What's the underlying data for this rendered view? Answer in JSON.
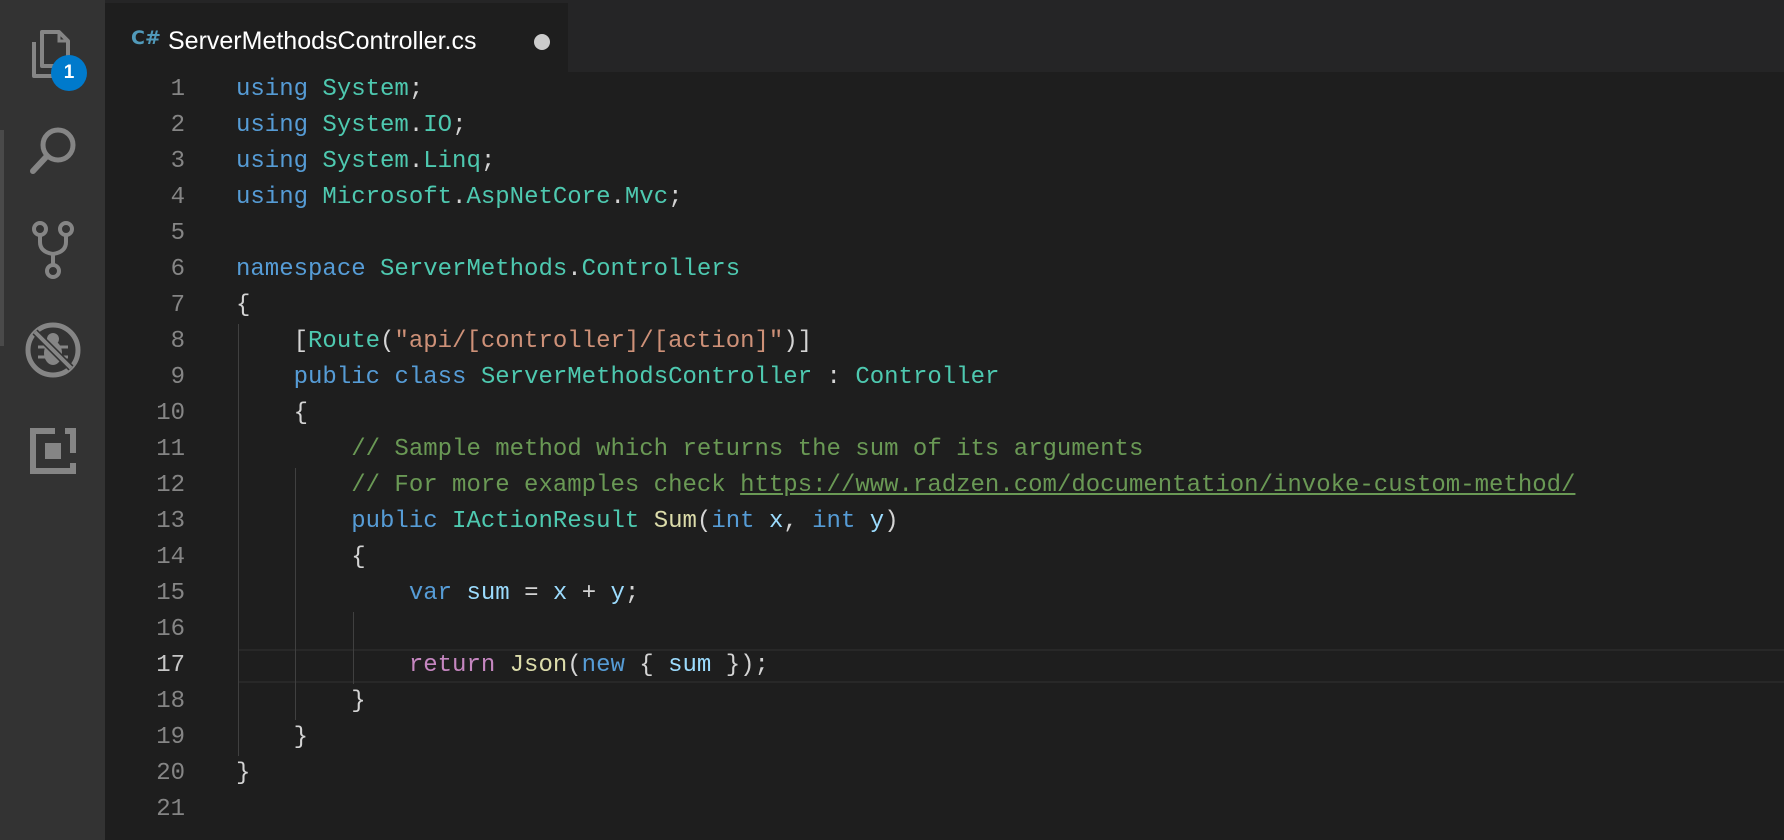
{
  "activity_bar": {
    "items": [
      {
        "name": "explorer",
        "icon": "files-icon",
        "badge": "1"
      },
      {
        "name": "search",
        "icon": "search-icon"
      },
      {
        "name": "source-control",
        "icon": "source-control-icon"
      },
      {
        "name": "debug",
        "icon": "debug-icon"
      },
      {
        "name": "extensions",
        "icon": "extensions-icon"
      }
    ]
  },
  "tab": {
    "lang_icon": "C#",
    "title": "ServerMethodsController.cs",
    "dirty": true
  },
  "editor": {
    "active_line": 17,
    "lines": [
      {
        "n": "1",
        "tokens": [
          [
            "kw",
            "using"
          ],
          [
            "punc",
            " "
          ],
          [
            "type",
            "System"
          ],
          [
            "punc",
            ";"
          ]
        ]
      },
      {
        "n": "2",
        "tokens": [
          [
            "kw",
            "using"
          ],
          [
            "punc",
            " "
          ],
          [
            "type",
            "System"
          ],
          [
            "punc",
            "."
          ],
          [
            "type",
            "IO"
          ],
          [
            "punc",
            ";"
          ]
        ]
      },
      {
        "n": "3",
        "tokens": [
          [
            "kw",
            "using"
          ],
          [
            "punc",
            " "
          ],
          [
            "type",
            "System"
          ],
          [
            "punc",
            "."
          ],
          [
            "type",
            "Linq"
          ],
          [
            "punc",
            ";"
          ]
        ]
      },
      {
        "n": "4",
        "tokens": [
          [
            "kw",
            "using"
          ],
          [
            "punc",
            " "
          ],
          [
            "type",
            "Microsoft"
          ],
          [
            "punc",
            "."
          ],
          [
            "type",
            "AspNetCore"
          ],
          [
            "punc",
            "."
          ],
          [
            "type",
            "Mvc"
          ],
          [
            "punc",
            ";"
          ]
        ]
      },
      {
        "n": "5",
        "tokens": []
      },
      {
        "n": "6",
        "tokens": [
          [
            "kw",
            "namespace"
          ],
          [
            "punc",
            " "
          ],
          [
            "type",
            "ServerMethods"
          ],
          [
            "punc",
            "."
          ],
          [
            "type",
            "Controllers"
          ]
        ]
      },
      {
        "n": "7",
        "tokens": [
          [
            "punc",
            "{"
          ]
        ]
      },
      {
        "n": "8",
        "tokens": [
          [
            "punc",
            "    ["
          ],
          [
            "type",
            "Route"
          ],
          [
            "punc",
            "("
          ],
          [
            "str",
            "\"api/[controller]/[action]\""
          ],
          [
            "punc",
            ")]"
          ]
        ]
      },
      {
        "n": "9",
        "tokens": [
          [
            "punc",
            "    "
          ],
          [
            "kw",
            "public"
          ],
          [
            "punc",
            " "
          ],
          [
            "kw",
            "class"
          ],
          [
            "punc",
            " "
          ],
          [
            "type",
            "ServerMethodsController"
          ],
          [
            "punc",
            " : "
          ],
          [
            "type",
            "Controller"
          ]
        ]
      },
      {
        "n": "10",
        "tokens": [
          [
            "punc",
            "    {"
          ]
        ]
      },
      {
        "n": "11",
        "tokens": [
          [
            "punc",
            "        "
          ],
          [
            "cmt",
            "// Sample method which returns the sum of its arguments"
          ]
        ]
      },
      {
        "n": "12",
        "tokens": [
          [
            "punc",
            "        "
          ],
          [
            "cmt",
            "// For more examples check "
          ],
          [
            "link",
            "https://www.radzen.com/documentation/invoke-custom-method/"
          ]
        ]
      },
      {
        "n": "13",
        "tokens": [
          [
            "punc",
            "        "
          ],
          [
            "kw",
            "public"
          ],
          [
            "punc",
            " "
          ],
          [
            "type",
            "IActionResult"
          ],
          [
            "punc",
            " "
          ],
          [
            "fn",
            "Sum"
          ],
          [
            "punc",
            "("
          ],
          [
            "kw",
            "int"
          ],
          [
            "punc",
            " "
          ],
          [
            "var",
            "x"
          ],
          [
            "punc",
            ", "
          ],
          [
            "kw",
            "int"
          ],
          [
            "punc",
            " "
          ],
          [
            "var",
            "y"
          ],
          [
            "punc",
            ")"
          ]
        ]
      },
      {
        "n": "14",
        "tokens": [
          [
            "punc",
            "        {"
          ]
        ]
      },
      {
        "n": "15",
        "tokens": [
          [
            "punc",
            "            "
          ],
          [
            "kw",
            "var"
          ],
          [
            "punc",
            " "
          ],
          [
            "var",
            "sum"
          ],
          [
            "punc",
            " = "
          ],
          [
            "var",
            "x"
          ],
          [
            "punc",
            " + "
          ],
          [
            "var",
            "y"
          ],
          [
            "punc",
            ";"
          ]
        ]
      },
      {
        "n": "16",
        "tokens": []
      },
      {
        "n": "17",
        "tokens": [
          [
            "punc",
            "            "
          ],
          [
            "ctrl",
            "return"
          ],
          [
            "punc",
            " "
          ],
          [
            "fn",
            "Json"
          ],
          [
            "punc",
            "("
          ],
          [
            "kw",
            "new"
          ],
          [
            "punc",
            " { "
          ],
          [
            "var",
            "sum"
          ],
          [
            "punc",
            " });"
          ]
        ]
      },
      {
        "n": "18",
        "tokens": [
          [
            "punc",
            "        }"
          ]
        ]
      },
      {
        "n": "19",
        "tokens": [
          [
            "punc",
            "    }"
          ]
        ]
      },
      {
        "n": "20",
        "tokens": [
          [
            "punc",
            "}"
          ]
        ]
      },
      {
        "n": "21",
        "tokens": []
      }
    ]
  }
}
